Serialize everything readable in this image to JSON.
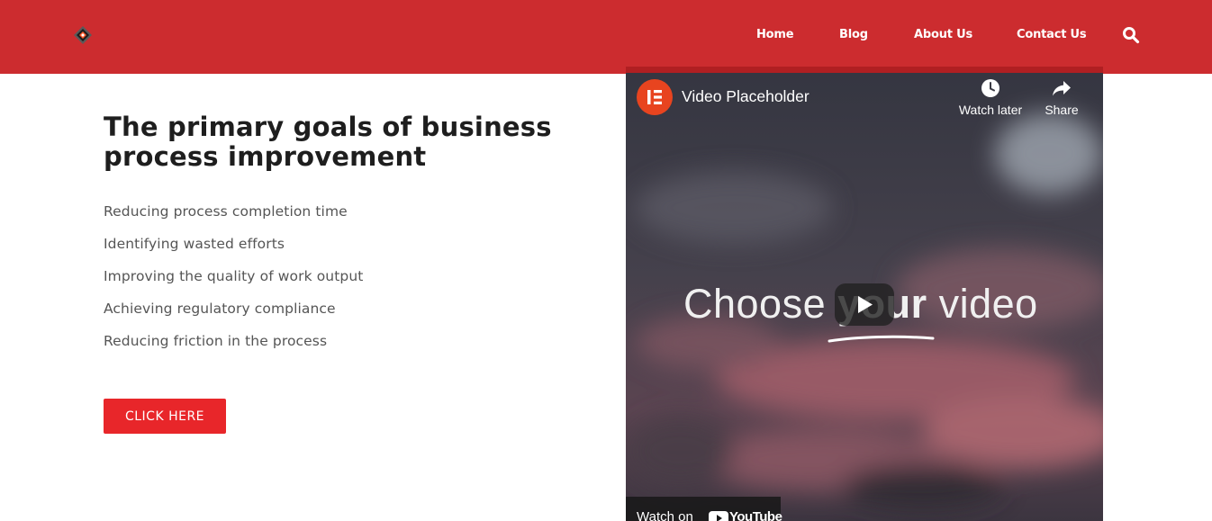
{
  "nav": {
    "items": [
      {
        "label": "Home"
      },
      {
        "label": "Blog"
      },
      {
        "label": "About Us"
      },
      {
        "label": "Contact Us"
      }
    ]
  },
  "main": {
    "title": "The primary goals of business process improvement",
    "goals": [
      "Reducing process completion time",
      "Identifying wasted efforts",
      "Improving the quality of work output",
      "Achieving regulatory compliance",
      "Reducing friction in the process"
    ],
    "cta_label": "CLICK HERE"
  },
  "video": {
    "title": "Video Placeholder",
    "watch_later": "Watch later",
    "share": "Share",
    "overlay_text": {
      "before": "Choose ",
      "bold": "your",
      "after": " video"
    },
    "watch_on": "Watch on",
    "youtube": "YouTube"
  },
  "colors": {
    "header": "#cc2c2f",
    "cta": "#e8262a",
    "channel_avatar": "#e8441f"
  }
}
